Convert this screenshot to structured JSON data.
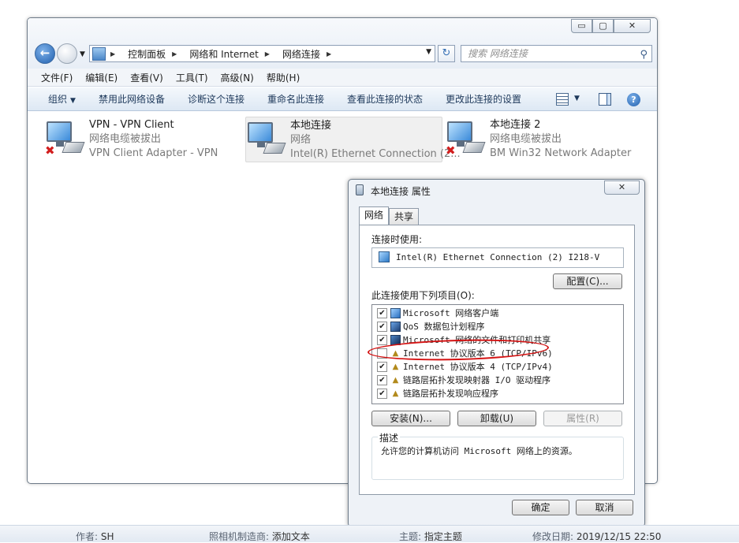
{
  "window": {
    "buttons": {
      "minimize": "▭",
      "maximize": "▢",
      "close": "✕"
    }
  },
  "nav": {
    "breadcrumbs": [
      "控制面板",
      "网络和 Internet",
      "网络连接"
    ],
    "search_placeholder": "搜索 网络连接"
  },
  "menu": [
    "文件(F)",
    "编辑(E)",
    "查看(V)",
    "工具(T)",
    "高级(N)",
    "帮助(H)"
  ],
  "commands": [
    "组织",
    "禁用此网络设备",
    "诊断这个连接",
    "重命名此连接",
    "查看此连接的状态",
    "更改此连接的设置"
  ],
  "connections": [
    {
      "name": "VPN - VPN Client",
      "status": "网络电缆被拔出",
      "adapter": "VPN Client Adapter - VPN",
      "disconnected": true
    },
    {
      "name": "本地连接",
      "status": "网络",
      "adapter": "Intel(R) Ethernet Connection (2...",
      "disconnected": false,
      "selected": true
    },
    {
      "name": "本地连接 2",
      "status": "网络电缆被拔出",
      "adapter": "BM Win32 Network Adapter",
      "disconnected": true
    }
  ],
  "dialog": {
    "title": "本地连接 属性",
    "close": "✕",
    "tabs": [
      "网络",
      "共享"
    ],
    "connect_using_label": "连接时使用:",
    "adapter": "Intel(R) Ethernet Connection (2) I218-V",
    "configure_button": "配置(C)...",
    "items_label": "此连接使用下列项目(O):",
    "items": [
      {
        "label": "Microsoft 网络客户端",
        "checked": true,
        "icon": "client"
      },
      {
        "label": "QoS 数据包计划程序",
        "checked": true,
        "icon": "qos"
      },
      {
        "label": "Microsoft 网络的文件和打印机共享",
        "checked": true,
        "icon": "share"
      },
      {
        "label": "Internet 协议版本 6 (TCP/IPv6)",
        "checked": false,
        "icon": "proto"
      },
      {
        "label": "Internet 协议版本 4 (TCP/IPv4)",
        "checked": true,
        "icon": "proto"
      },
      {
        "label": "链路层拓扑发现映射器 I/O 驱动程序",
        "checked": true,
        "icon": "proto"
      },
      {
        "label": "链路层拓扑发现响应程序",
        "checked": true,
        "icon": "proto"
      }
    ],
    "install_button": "安装(N)...",
    "uninstall_button": "卸载(U)",
    "properties_button": "属性(R)",
    "description_title": "描述",
    "description_text": "允许您的计算机访问 Microsoft 网络上的资源。",
    "ok_button": "确定",
    "cancel_button": "取消"
  },
  "statusbar": {
    "author_key": "作者:",
    "author_val": "SH",
    "camera_key": "照相机制造商:",
    "camera_val": "添加文本",
    "subject_key": "主题:",
    "subject_val": "指定主题",
    "modified_key": "修改日期:",
    "modified_val": "2019/12/15 22:50"
  }
}
